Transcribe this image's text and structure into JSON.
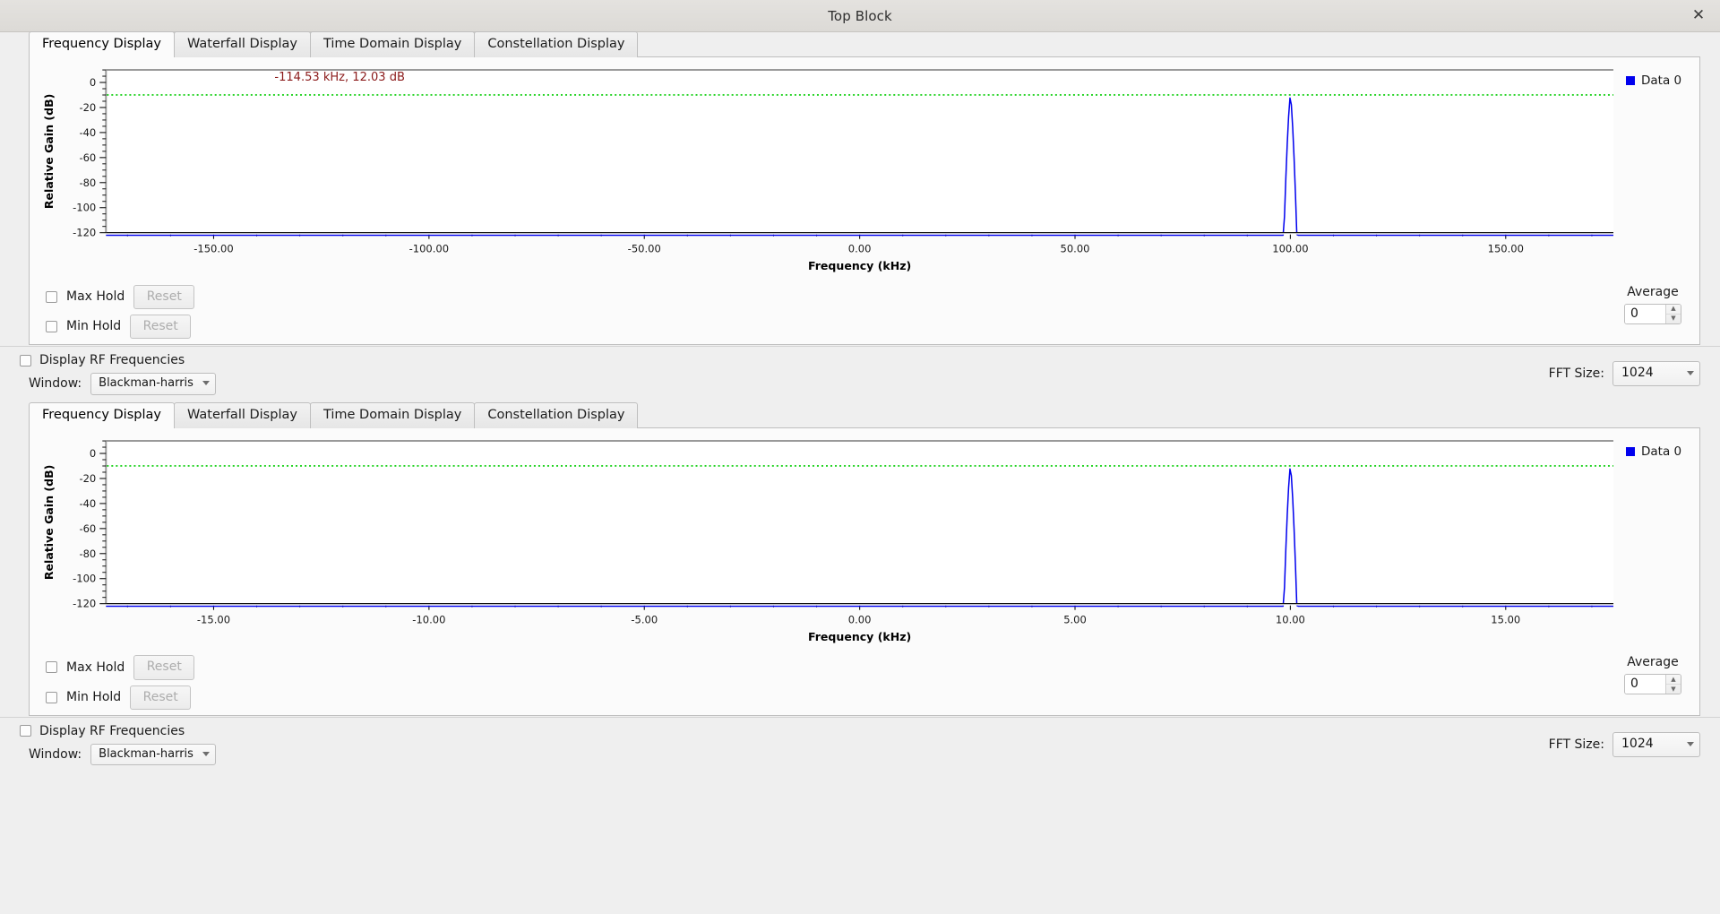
{
  "window": {
    "title": "Top Block",
    "close_icon": "close-icon",
    "close_glyph": "✕"
  },
  "tabs": [
    "Frequency Display",
    "Waterfall Display",
    "Time Domain Display",
    "Constellation Display"
  ],
  "active_tab": "Frequency Display",
  "controls": {
    "max_hold_label": "Max Hold",
    "min_hold_label": "Min Hold",
    "reset_label": "Reset",
    "average_label": "Average",
    "average_value": "0",
    "display_rf_label": "Display RF Frequencies",
    "window_label": "Window:",
    "window_value": "Blackman-harris",
    "fft_size_label": "FFT Size:",
    "fft_size_value": "1024",
    "spin_up_glyph": "▲",
    "spin_down_glyph": "▼"
  },
  "legend": {
    "series_label": "Data 0",
    "color": "#0000ee"
  },
  "colors": {
    "trace": "#0000ee",
    "reference_line": "#00cc00",
    "annotation": "#8b1a1a",
    "axis": "#000000",
    "plot_bg": "#ffffff",
    "panel_bg": "#fbfbfb",
    "window_bg": "#efefef",
    "titlebar_bg": "#dedcd8"
  },
  "chart_data": [
    {
      "id": "frequency-display-top",
      "type": "line",
      "title": "",
      "xlabel": "Frequency (kHz)",
      "ylabel": "Relative Gain (dB)",
      "xlim": [
        -175.0,
        175.0
      ],
      "ylim": [
        -120,
        10
      ],
      "xticks": [
        -150.0,
        -100.0,
        -50.0,
        0.0,
        50.0,
        100.0,
        150.0
      ],
      "xtick_labels": [
        "-150.00",
        "-100.00",
        "-50.00",
        "0.00",
        "50.00",
        "100.00",
        "150.00"
      ],
      "yticks": [
        0,
        -20,
        -40,
        -60,
        -80,
        -100,
        -120
      ],
      "ytick_labels": [
        "0",
        "-20",
        "-40",
        "-60",
        "-80",
        "-100",
        "-120"
      ],
      "grid": false,
      "legend": [
        "Data 0"
      ],
      "legend_position": "right",
      "annotation": "-114.53 kHz, 12.03 dB",
      "annotation_x": -114.53,
      "annotation_y": 12.03,
      "reference_line_y": -10,
      "series": [
        {
          "name": "Data 0",
          "color": "#0000ee",
          "noise_floor_db": -122,
          "peak_frequency_khz": 100.0,
          "peak_gain_db": -10.5,
          "peak_halfwidth_khz": 1.2,
          "x": [
            -175,
            -120,
            -80,
            -40,
            0,
            40,
            80,
            97.8,
            98.6,
            99.2,
            99.6,
            99.9,
            100.0,
            100.2,
            100.6,
            101.0,
            101.8,
            103,
            120,
            150,
            175
          ],
          "y": [
            -122,
            -122,
            -122,
            -122,
            -122,
            -122,
            -122,
            -121,
            -100,
            -62,
            -32,
            -14,
            -10.5,
            -13,
            -30,
            -58,
            -96,
            -121,
            -122,
            -122,
            -122
          ]
        }
      ]
    },
    {
      "id": "frequency-display-bottom",
      "type": "line",
      "title": "",
      "xlabel": "Frequency (kHz)",
      "ylabel": "Relative Gain (dB)",
      "xlim": [
        -17.5,
        17.5
      ],
      "ylim": [
        -120,
        10
      ],
      "xticks": [
        -15.0,
        -10.0,
        -5.0,
        0.0,
        5.0,
        10.0,
        15.0
      ],
      "xtick_labels": [
        "-15.00",
        "-10.00",
        "-5.00",
        "0.00",
        "5.00",
        "10.00",
        "15.00"
      ],
      "yticks": [
        0,
        -20,
        -40,
        -60,
        -80,
        -100,
        -120
      ],
      "ytick_labels": [
        "0",
        "-20",
        "-40",
        "-60",
        "-80",
        "-100",
        "-120"
      ],
      "grid": false,
      "legend": [
        "Data 0"
      ],
      "legend_position": "right",
      "annotation": "",
      "reference_line_y": -10,
      "series": [
        {
          "name": "Data 0",
          "color": "#0000ee",
          "noise_floor_db": -122,
          "peak_frequency_khz": 10.0,
          "peak_gain_db": -10.5,
          "peak_halfwidth_khz": 0.12,
          "x": [
            -17.5,
            -12,
            -8,
            -4,
            0,
            4,
            8,
            9.78,
            9.86,
            9.92,
            9.96,
            9.99,
            10.0,
            10.02,
            10.06,
            10.1,
            10.18,
            10.3,
            12,
            15,
            17.5
          ],
          "y": [
            -122,
            -122,
            -122,
            -122,
            -122,
            -122,
            -122,
            -121,
            -100,
            -62,
            -32,
            -14,
            -10.5,
            -13,
            -30,
            -58,
            -96,
            -121,
            -122,
            -122,
            -122
          ]
        }
      ]
    }
  ]
}
